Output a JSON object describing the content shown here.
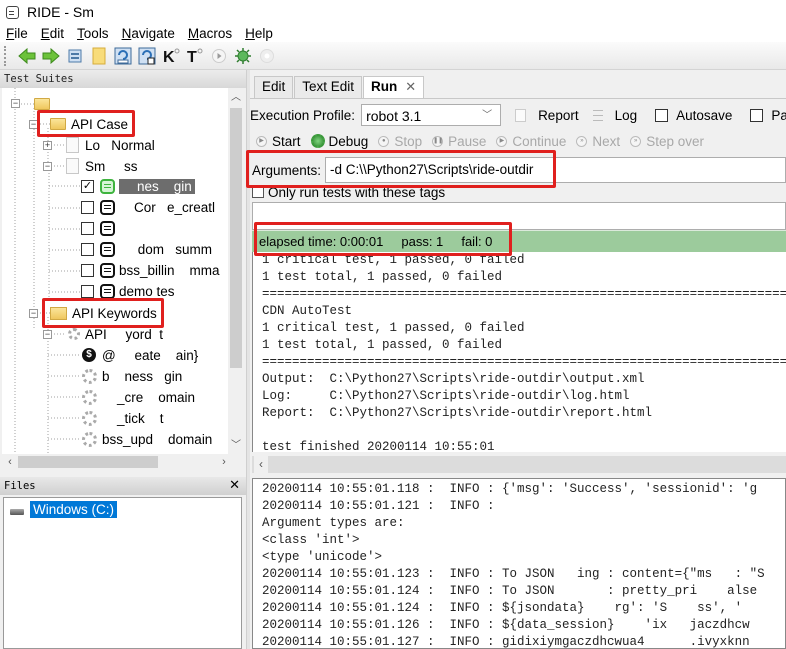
{
  "window": {
    "title": "RIDE - Sm"
  },
  "menu": [
    {
      "label": "File",
      "accel": "F",
      "rest": "ile"
    },
    {
      "label": "Edit",
      "accel": "E",
      "rest": "dit"
    },
    {
      "label": "Tools",
      "accel": "T",
      "rest": "ools"
    },
    {
      "label": "Navigate",
      "accel": "N",
      "rest": "avigate"
    },
    {
      "label": "Macros",
      "accel": "M",
      "rest": "acros"
    },
    {
      "label": "Help",
      "accel": "H",
      "rest": "elp"
    }
  ],
  "toolbar": {
    "buttons": [
      "back",
      "forward",
      "open-suite",
      "open-directory",
      "save",
      "save-all",
      "search-keywords",
      "search-tests",
      "run",
      "debug",
      "stop"
    ],
    "k_label": "K",
    "t_label": "T"
  },
  "test_suites": {
    "header": "Test Suites",
    "root_label": "",
    "api_case": "API Case",
    "suite_1": "Lo   Normal",
    "suite_2": "Sm     ss",
    "tests": [
      {
        "label": "    nes    gin",
        "checked": true,
        "selected": true
      },
      {
        "label": "    Cor   e_creatl",
        "checked": false
      },
      {
        "label": "",
        "checked": false
      },
      {
        "label": "     dom   summ",
        "checked": false
      },
      {
        "label": "bss_billin    mma",
        "checked": false
      },
      {
        "label": "demo tes",
        "checked": false
      }
    ],
    "api_keywords": "API Keywords",
    "keyword_file": "API     yord  t",
    "keywords": [
      {
        "label": "@     eate    ain}",
        "icon": "dollar"
      },
      {
        "label": "b    ness   gin",
        "icon": "gear"
      },
      {
        "label": "    _cre    omain",
        "icon": "gear"
      },
      {
        "label": "    _tick    t",
        "icon": "gear"
      },
      {
        "label": "bss_upd    domain",
        "icon": "gear"
      }
    ]
  },
  "files": {
    "header": "Files",
    "close": "✕",
    "drive": "Windows (C:)"
  },
  "tabs": [
    {
      "label": "Edit",
      "active": false
    },
    {
      "label": "Text Edit",
      "active": false
    },
    {
      "label": "Run",
      "active": true,
      "close": "✕"
    }
  ],
  "run": {
    "profile_label": "Execution Profile:",
    "profile_value": "robot 3.1",
    "report_label": "Report",
    "log_label": "Log",
    "autosave_label": "Autosave",
    "autosave_checked": false,
    "pause_label": "Pause on fa",
    "pause_checked": false,
    "controls": [
      {
        "label": "Start",
        "enabled": true
      },
      {
        "label": "Debug",
        "enabled": true
      },
      {
        "label": "Stop",
        "enabled": false
      },
      {
        "label": "Pause",
        "enabled": false
      },
      {
        "label": "Continue",
        "enabled": false
      },
      {
        "label": "Next",
        "enabled": false
      },
      {
        "label": "Step over",
        "enabled": false
      }
    ],
    "arguments_label": "Arguments:",
    "arguments_value": "-d C:\\\\Python27\\Scripts\\ride-outdir",
    "only_tags_label": "Only run tests with these tags",
    "only_tags_checked": false,
    "tags_value": "",
    "status": {
      "text": "elapsed time: 0:00:01     pass: 1     fail: 0",
      "elapsed": "0:00:01",
      "pass": 1,
      "fail": 0,
      "color": "#9ccb9c"
    }
  },
  "console_lines": [
    "1 critical test, 1 passed, 0 failed",
    "1 test total, 1 passed, 0 failed",
    "==============================================================================",
    "CDN AutoTest",
    "1 critical test, 1 passed, 0 failed",
    "1 test total, 1 passed, 0 failed",
    "==============================================================================",
    "Output:  C:\\Python27\\Scripts\\ride-outdir\\output.xml",
    "Log:     C:\\Python27\\Scripts\\ride-outdir\\log.html",
    "Report:  C:\\Python27\\Scripts\\ride-outdir\\report.html",
    "",
    "test finished 20200114 10:55:01"
  ],
  "log_lines": [
    "20200114 10:55:01.118 :  INFO : {'msg': 'Success', 'sessionid': 'g",
    "20200114 10:55:01.121 :  INFO :",
    "Argument types are:",
    "<class 'int'>",
    "<type 'unicode'>",
    "20200114 10:55:01.123 :  INFO : To JSON   ing : content={\"ms   : \"S",
    "20200114 10:55:01.124 :  INFO : To JSON       : pretty_pri    alse",
    "20200114 10:55:01.124 :  INFO : ${jsondata}    rg': 'S    ss', '",
    "20200114 10:55:01.126 :  INFO : ${data_session}    'ix   jaczdhcw",
    "20200114 10:55:01.127 :  INFO : gidixiymgaczdhcwua4      .ivyxknn"
  ]
}
